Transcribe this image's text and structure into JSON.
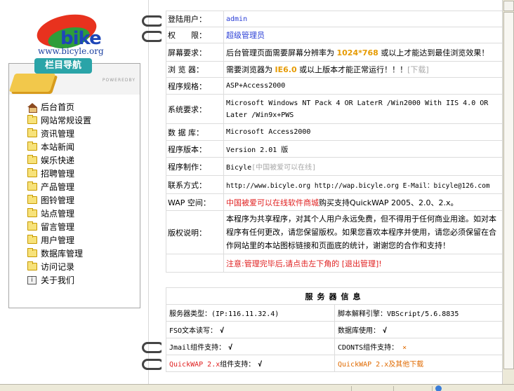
{
  "logo": {
    "brand": "bike",
    "url": "www.bicyle.org"
  },
  "nav": {
    "title": "栏目导航",
    "powered": "POWEREDBY",
    "items": [
      {
        "label": "后台首页",
        "icon": "home-icon"
      },
      {
        "label": "网站常规设置",
        "icon": "folder-icon"
      },
      {
        "label": "资讯管理",
        "icon": "folder-icon"
      },
      {
        "label": "本站新闻",
        "icon": "folder-icon"
      },
      {
        "label": "娱乐快递",
        "icon": "folder-icon"
      },
      {
        "label": "招聘管理",
        "icon": "folder-icon"
      },
      {
        "label": "产品管理",
        "icon": "folder-icon"
      },
      {
        "label": "图铃管理",
        "icon": "folder-icon"
      },
      {
        "label": "站点管理",
        "icon": "folder-icon"
      },
      {
        "label": "留言管理",
        "icon": "folder-icon"
      },
      {
        "label": "用户管理",
        "icon": "folder-icon"
      },
      {
        "label": "数据库管理",
        "icon": "folder-icon"
      },
      {
        "label": "访问记录",
        "icon": "folder-icon"
      },
      {
        "label": "关于我们",
        "icon": "info-icon"
      }
    ]
  },
  "info": {
    "user_label": "登陆用户：",
    "user_value": "admin",
    "perm_label": "权　　限：",
    "perm_value": "超级管理员",
    "screen_label": "屏幕要求：",
    "screen_pre": "后台管理页面需要屏幕分辨率为",
    "screen_res": "1024*768",
    "screen_post": "或以上才能达到最佳浏览效果！",
    "browser_label": "浏 览 器：",
    "browser_pre": "需要浏览器为",
    "browser_ver": "IE6.0",
    "browser_post": "或以上版本才能正常运行！！！",
    "browser_link": "[下载]",
    "spec_label": "程序规格：",
    "spec_value": "ASP+Access2000",
    "sys_label": "系统要求：",
    "sys_value": "Microsoft Windows NT Pack 4 OR LaterR /Win2000 With IIS 4.0 OR Later /Win9x+PWS",
    "db_label": "数 据 库：",
    "db_value": "Microsoft Access2000",
    "ver_label": "程序版本：",
    "ver_value": "Version 2.01 版",
    "maker_label": "程序制作：",
    "maker_value": "Bicyle",
    "maker_note": "[中国被爱可以在线]",
    "contact_label": "联系方式：",
    "contact_value": "http://www.bicyle.org http://wap.bicyle.org  E-Mail：bicyle@126.com",
    "wap_label": "WAP 空间：",
    "wap_link": "中国被爱可以在线软件商城",
    "wap_post": "购买支持QuickWAP 2005、2.0、2.x。",
    "copy_label": "版权说明：",
    "copy_value": "本程序为共享程序，对其个人用户永远免费，但不得用于任何商业用途。如对本程序有任何更改，请您保留版权。如果您喜欢本程序并使用，请您必须保留在合作网站里的本站图标链接和页面底的统计，谢谢您的合作和支持！",
    "notice": "注意:管理完毕后,请点击左下角的 [退出管理]!"
  },
  "server": {
    "title": "服务器信息",
    "type_label": "服务器类型：",
    "type_value": "(IP:116.11.32.4)",
    "script_label": "脚本解释引擎：",
    "script_value": "VBScript/5.6.8835",
    "fso_label": "FSO文本读写：",
    "fso_mark": "√",
    "dbuse_label": "数据库使用：",
    "dbuse_mark": "√",
    "jmail_label": "Jmail组件支持：",
    "jmail_mark": "√",
    "cdonts_label": "CDONTS组件支持：",
    "cdonts_mark": "×",
    "qw_name": "QuickWAP 2.x",
    "qw_label": "组件支持：",
    "qw_mark": "√",
    "qw_dl_name": "QuickWAP 2.x",
    "qw_dl_post": "及其他下载"
  },
  "colors": {
    "accent": "#2aa4a8",
    "link_red": "#e02020",
    "link_blue": "#2b3fd6",
    "highlight": "#e69a00"
  }
}
